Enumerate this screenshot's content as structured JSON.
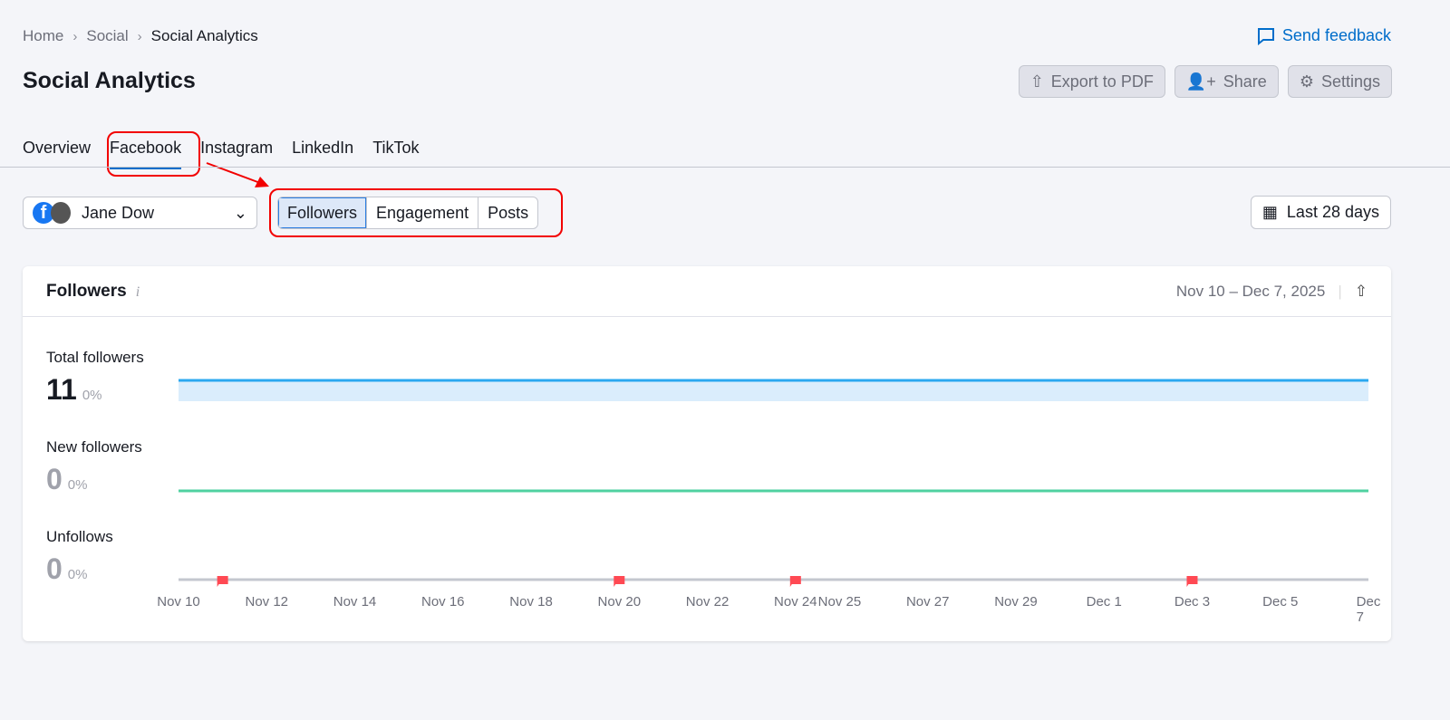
{
  "breadcrumb": [
    "Home",
    "Social",
    "Social Analytics"
  ],
  "send_feedback": "Send feedback",
  "title": "Social Analytics",
  "actions": {
    "export": "Export to PDF",
    "share": "Share",
    "settings": "Settings"
  },
  "tabs": [
    "Overview",
    "Facebook",
    "Instagram",
    "LinkedIn",
    "TikTok"
  ],
  "active_tab": "Facebook",
  "profile": {
    "name": "Jane Dow"
  },
  "segments": [
    "Followers",
    "Engagement",
    "Posts"
  ],
  "date_range": "Last 28 days",
  "card": {
    "title": "Followers",
    "period": "Nov 10 – Dec 7, 2025"
  },
  "metrics": [
    {
      "label": "Total followers",
      "value": "11",
      "change": "0%"
    },
    {
      "label": "New followers",
      "value": "0",
      "change": "0%"
    },
    {
      "label": "Unfollows",
      "value": "0",
      "change": "0%"
    }
  ],
  "colors": {
    "accent": "#006dca",
    "total": "#2ba8f0",
    "new": "#4fd1a0",
    "unfollows": "#c4c7cf",
    "marker": "#ff4953",
    "highlight": "#f20000"
  },
  "chart_data": {
    "type": "line",
    "x_range": [
      "Nov 10",
      "Dec 7"
    ],
    "tick_labels": [
      "Nov 10",
      "Nov 12",
      "Nov 14",
      "Nov 16",
      "Nov 18",
      "Nov 20",
      "Nov 22",
      "Nov 24",
      "Nov 25",
      "Nov 27",
      "Nov 29",
      "Dec 1",
      "Dec 3",
      "Dec 5",
      "Dec 7"
    ],
    "tick_days": [
      10,
      12,
      14,
      16,
      18,
      20,
      22,
      24,
      25,
      27,
      29,
      31,
      33,
      35,
      37
    ],
    "series": [
      {
        "name": "Total followers",
        "constant_value": 11
      },
      {
        "name": "New followers",
        "constant_value": 0
      },
      {
        "name": "Unfollows",
        "constant_value": 0
      }
    ],
    "markers": [
      "Nov 11",
      "Nov 20",
      "Nov 24",
      "Dec 3"
    ],
    "marker_days": [
      11,
      20,
      24,
      33
    ]
  }
}
